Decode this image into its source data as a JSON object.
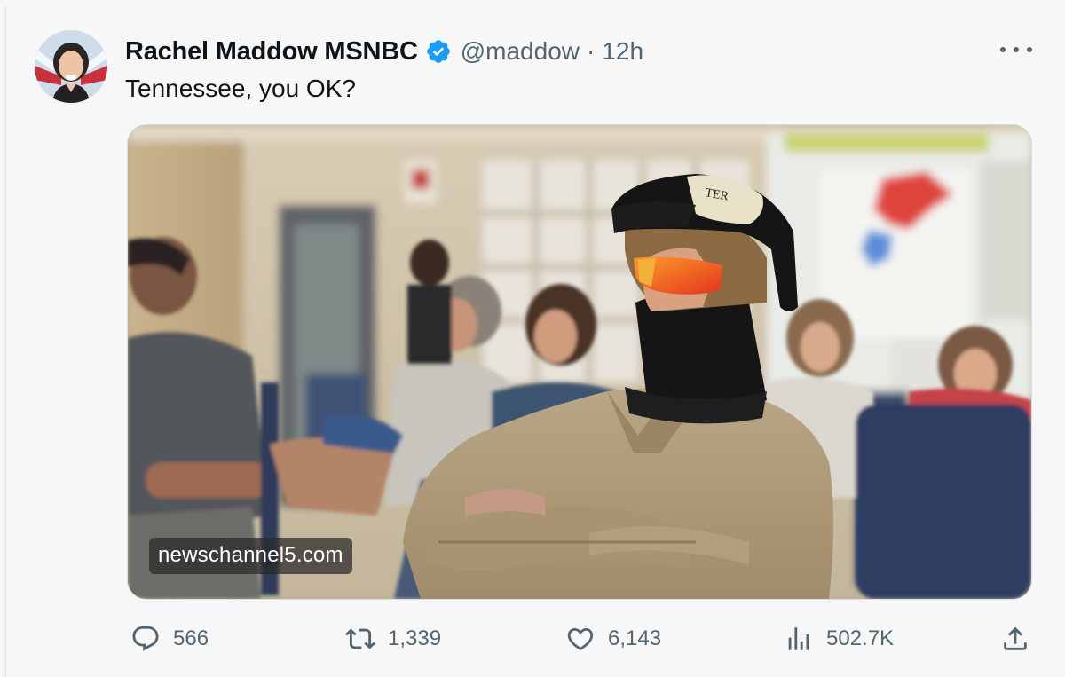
{
  "author": {
    "display_name": "Rachel Maddow MSNBC",
    "handle": "@maddow",
    "separator": "·",
    "timestamp": "12h",
    "verified": true
  },
  "tweet": {
    "text": "Tennessee, you OK?"
  },
  "media": {
    "source_label": "newschannel5.com"
  },
  "actions": {
    "replies": "566",
    "retweets": "1,339",
    "likes": "6,143",
    "views": "502.7K"
  },
  "icons": {
    "verified": "verified-badge-icon",
    "more": "more-options-icon",
    "reply": "reply-icon",
    "retweet": "retweet-icon",
    "like": "heart-icon",
    "views": "views-chart-icon",
    "share": "share-icon"
  },
  "colors": {
    "verified_blue": "#1d9bf0",
    "secondary_text": "#536471",
    "primary_text": "#0f1419"
  }
}
